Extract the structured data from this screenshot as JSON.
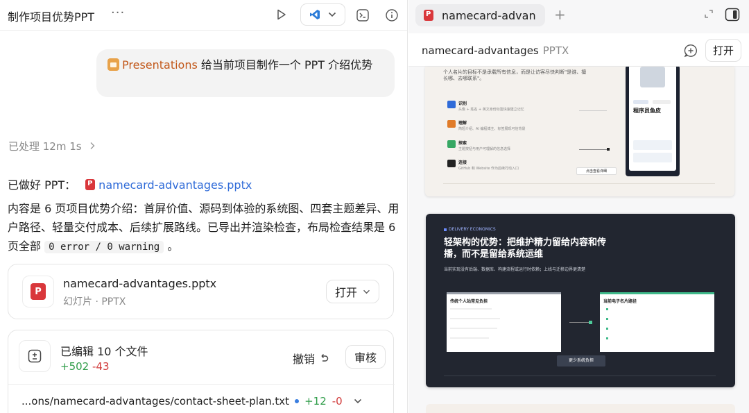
{
  "left": {
    "title": "制作项目优势PPT",
    "prompt_tag": "Presentations",
    "prompt_text": " 给当前项目制作一个 PPT 介绍优势",
    "processed": "已处理 12m 1s",
    "done_prefix": "已做好 PPT：",
    "done_link": "namecard-advantages.pptx",
    "para_text": "内容是 6 页项目优势介绍：首屏价值、源码到体验的系统图、四套主题差异、用户路径、轻量交付成本、后续扩展路线。已导出并渲染检查，布局检查结果是 6 页全部 ",
    "para_code": "0 error / 0 warning",
    "para_end": " 。",
    "file_card": {
      "name": "namecard-advantages.pptx",
      "sub": "幻灯片 · PPTX",
      "open_label": "打开"
    },
    "edit_card": {
      "title": "已编辑 10 个文件",
      "added": "+502",
      "removed": "-43",
      "undo_label": "撤销",
      "review_label": "审核",
      "file_path": "...ons/namecard-advantages/contact-sheet-plan.txt",
      "file_added": "+12",
      "file_removed": "-0"
    }
  },
  "right": {
    "tab_label": "namecard-advan",
    "file_name": "namecard-advantages",
    "file_type": "PPTX",
    "open_label": "打开",
    "slide1": {
      "intro": "个人名片的目标不是承载所有信息，而是让访客尽快判断\"是谁、擅长哪、去哪联系\"。",
      "steps": [
        {
          "num": "01",
          "title": "识别",
          "desc": "头像 + 姓名 + 英文身份标签快速建立记忆"
        },
        {
          "num": "02",
          "title": "理解",
          "desc": "简短介绍、AI 编程博主、标签展现可信背景"
        },
        {
          "num": "03",
          "title": "探索",
          "desc": "主题按钮与用户可理解的信息选择"
        },
        {
          "num": "04",
          "title": "连接",
          "desc": "GitHub 和 Website 作为后续行动入口"
        }
      ],
      "card_name": "程序员鱼皮",
      "card_button": "点击查看详细"
    },
    "slide2": {
      "kicker": "DELIVERY ECONOMICS",
      "title": "轻架构的优势：把维护精力留给内容和传播，而不是留给系统运维",
      "subtitle": "当前实现没有后端、数据库、构建流程或运行时依赖；上线与迁移边界更清楚",
      "box_left": "传统个人站常见负担",
      "box_right": "当前电子名片路径",
      "button": "更少系统负担"
    }
  }
}
